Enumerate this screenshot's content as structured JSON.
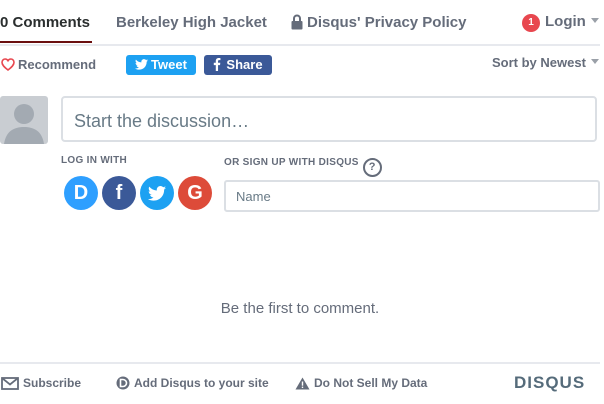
{
  "nav": {
    "comments_tab": "0 Comments",
    "site_tab": "Berkeley High Jacket",
    "privacy_tab": "Disqus' Privacy Policy",
    "login": {
      "badge": "1",
      "label": "Login"
    }
  },
  "actions": {
    "recommend": "Recommend",
    "tweet": "Tweet",
    "share": "Share",
    "sort": "Sort by Newest"
  },
  "composer": {
    "placeholder": "Start the discussion…"
  },
  "auth": {
    "login_with": "LOG IN WITH",
    "signup_label": "OR SIGN UP WITH DISQUS",
    "help": "?",
    "providers": [
      {
        "name": "Disqus",
        "letter": "D",
        "color": "#2e9fff"
      },
      {
        "name": "Facebook",
        "letter": "f",
        "color": "#3b5998"
      },
      {
        "name": "Twitter",
        "letter": "",
        "color": "#1da1f2"
      },
      {
        "name": "Google",
        "letter": "G",
        "color": "#dd4b39"
      }
    ],
    "name_placeholder": "Name"
  },
  "empty_message": "Be the first to comment.",
  "footer": {
    "subscribe": "Subscribe",
    "add_disqus": "Add Disqus to your site",
    "do_not_sell": "Do Not Sell My Data",
    "logo": "DISQUS"
  }
}
